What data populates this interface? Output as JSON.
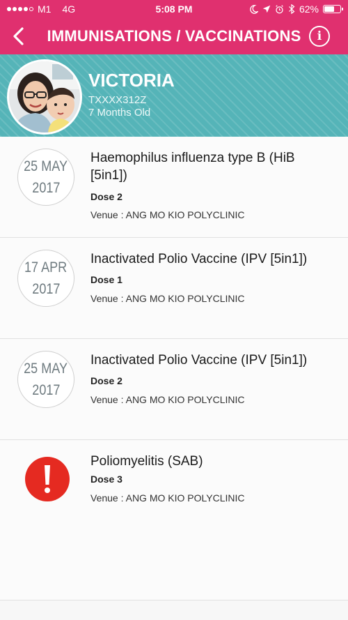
{
  "status_bar": {
    "carrier": "M1",
    "network": "4G",
    "time": "5:08 PM",
    "battery": "62%",
    "battery_level": 0.62
  },
  "header": {
    "title": "IMMUNISATIONS / VACCINATIONS",
    "info_label": "i"
  },
  "profile": {
    "name": "VICTORIA",
    "id": "TXXXX312Z",
    "age": "7 Months Old"
  },
  "colors": {
    "brand": "#e0306f",
    "profile_bg": "#55b4b8",
    "alert": "#e52a21"
  },
  "records": [
    {
      "day": "25 MAY",
      "year": "2017",
      "title": "Haemophilus influenza type B (HiB [5in1])",
      "dose": "Dose 2",
      "venue": "Venue : ANG MO KIO POLYCLINIC"
    },
    {
      "day": "17 APR",
      "year": "2017",
      "title": "Inactivated Polio Vaccine (IPV [5in1])",
      "dose": "Dose 1",
      "venue": "Venue : ANG MO KIO POLYCLINIC"
    },
    {
      "day": "25 MAY",
      "year": "2017",
      "title": "Inactivated Polio Vaccine (IPV [5in1])",
      "dose": "Dose 2",
      "venue": "Venue : ANG MO KIO POLYCLINIC"
    },
    {
      "alert_icon": "exclamation-icon",
      "title": "Poliomyelitis (SAB)",
      "dose": "Dose 3",
      "venue": "Venue : ANG MO KIO POLYCLINIC"
    }
  ]
}
